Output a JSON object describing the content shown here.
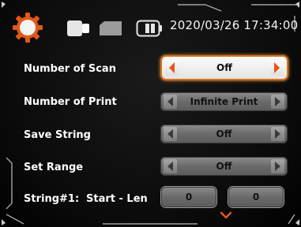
{
  "header": {
    "datetime": "2020/03/26 17:34:00",
    "icons": [
      "settings-gear-icon",
      "device-icon",
      "folder-icon",
      "battery-icon"
    ]
  },
  "settings": [
    {
      "label": "Number of Scan",
      "value": "Off",
      "selected": true
    },
    {
      "label": "Number of Print",
      "value": "Infinite Print",
      "selected": false
    },
    {
      "label": "Save String",
      "value": "Off",
      "selected": false
    },
    {
      "label": "Set Range",
      "value": "Off",
      "selected": false
    }
  ],
  "string_row": {
    "label": "String#1:",
    "sublabel": "Start - Len",
    "start": "0",
    "len": "0"
  },
  "colors": {
    "accent": "#e2571a",
    "highlight": "#f39a3a",
    "text": "#ffffff"
  }
}
